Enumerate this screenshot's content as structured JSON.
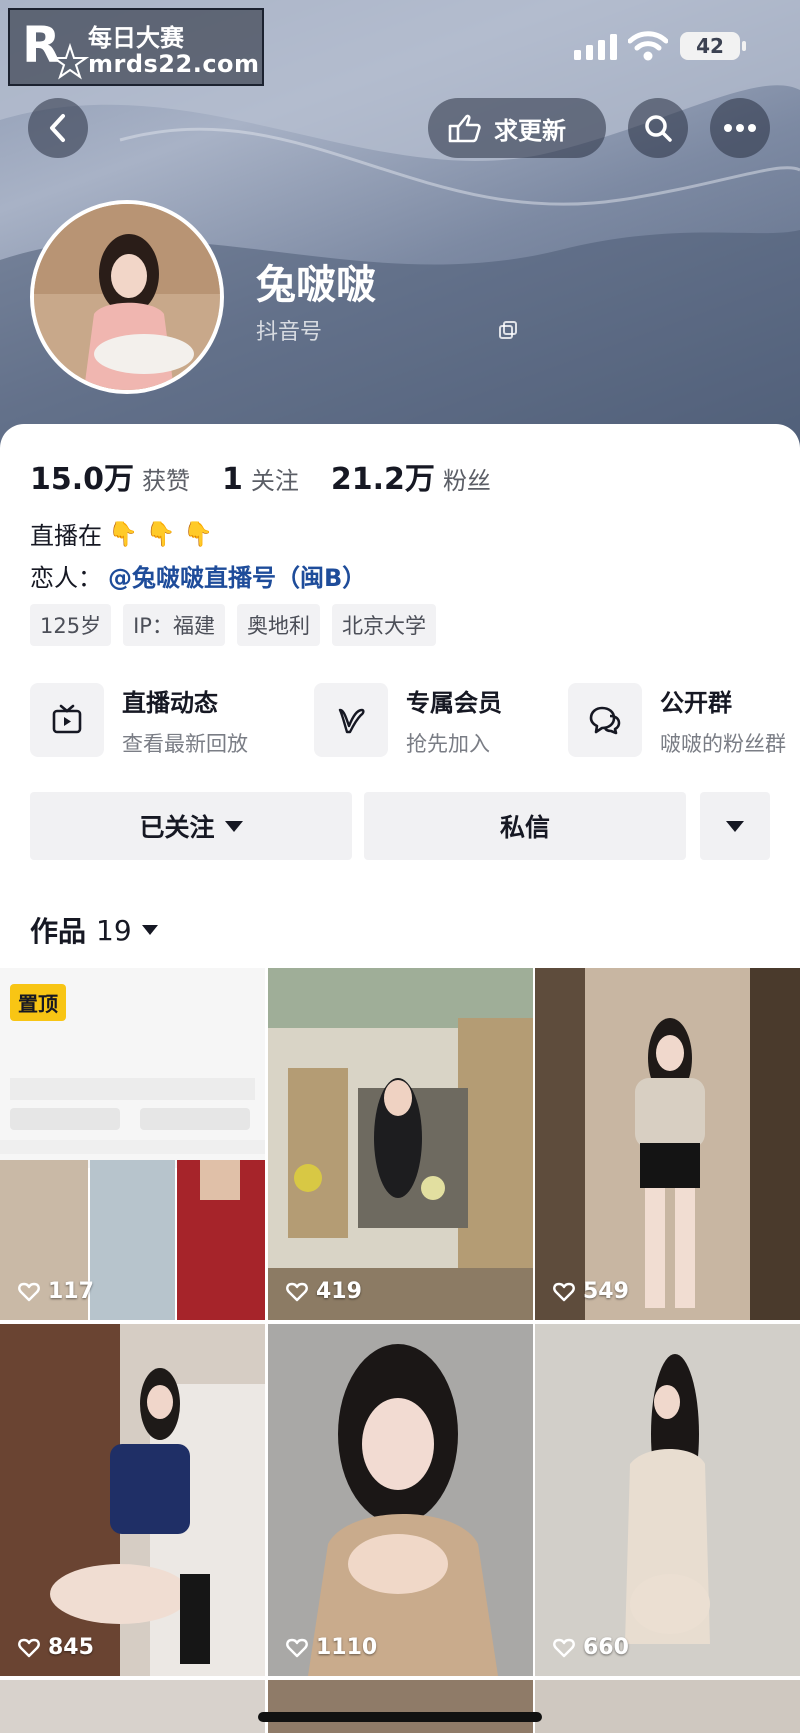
{
  "watermark": {
    "title": "每日大赛",
    "url": "mrds22.com"
  },
  "status_bar": {
    "battery": "42"
  },
  "header": {
    "request_update_label": "求更新"
  },
  "profile": {
    "nickname": "兔啵啵",
    "douyin_id_label": "抖音号"
  },
  "stats": [
    {
      "value": "15.0万",
      "label": "获赞"
    },
    {
      "value": "1",
      "label": "关注"
    },
    {
      "value": "21.2万",
      "label": "粉丝"
    }
  ],
  "bio": {
    "line1": "直播在",
    "line1_emoji": "👇 👇 👇",
    "line2_prefix": "恋人：",
    "line2_link": "@兔啵啵直播号（闽B）"
  },
  "tags": [
    "125岁",
    "IP：福建",
    "奥地利",
    "北京大学"
  ],
  "services": [
    {
      "title": "直播动态",
      "subtitle": "查看最新回放",
      "icon": "tv-icon"
    },
    {
      "title": "专属会员",
      "subtitle": "抢先加入",
      "icon": "v-icon"
    },
    {
      "title": "公开群",
      "subtitle": "啵啵的粉丝群",
      "icon": "chat-group-icon"
    }
  ],
  "actions": {
    "followed_label": "已关注",
    "message_label": "私信"
  },
  "works_tab": {
    "label": "作品",
    "count": "19"
  },
  "videos": [
    {
      "likes": "117",
      "pinned_label": "置顶"
    },
    {
      "likes": "419"
    },
    {
      "likes": "549"
    },
    {
      "likes": "845"
    },
    {
      "likes": "1110"
    },
    {
      "likes": "660"
    }
  ],
  "colors": {
    "accent_link": "#1e4c9a",
    "pin_badge": "#f8c514"
  }
}
